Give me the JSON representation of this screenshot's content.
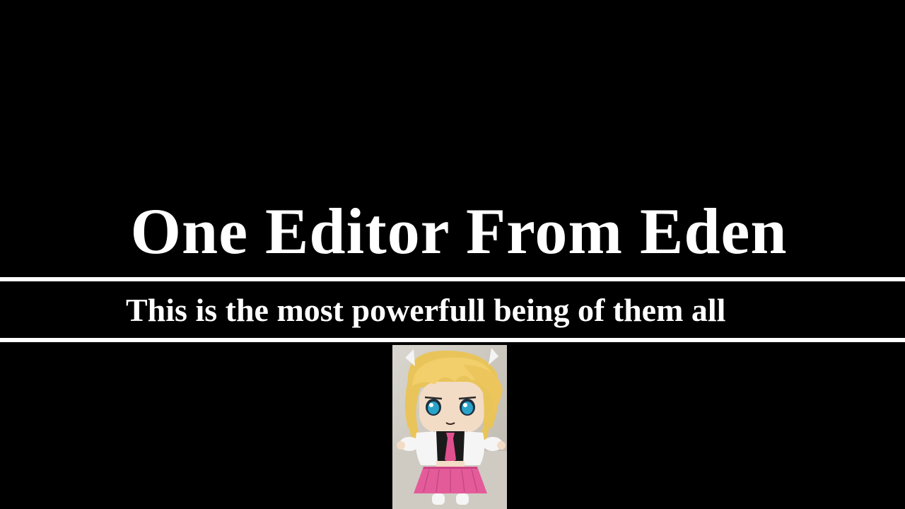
{
  "slide": {
    "title": "One Editor From Eden",
    "subtitle": "This is the most powerfull being of them all"
  },
  "image": {
    "subject": "plush doll with blonde hair, blue eyes, white jacket, black top, pink tie and pink skirt"
  },
  "colors": {
    "background": "#000000",
    "text": "#ffffff",
    "rule": "#ffffff"
  }
}
